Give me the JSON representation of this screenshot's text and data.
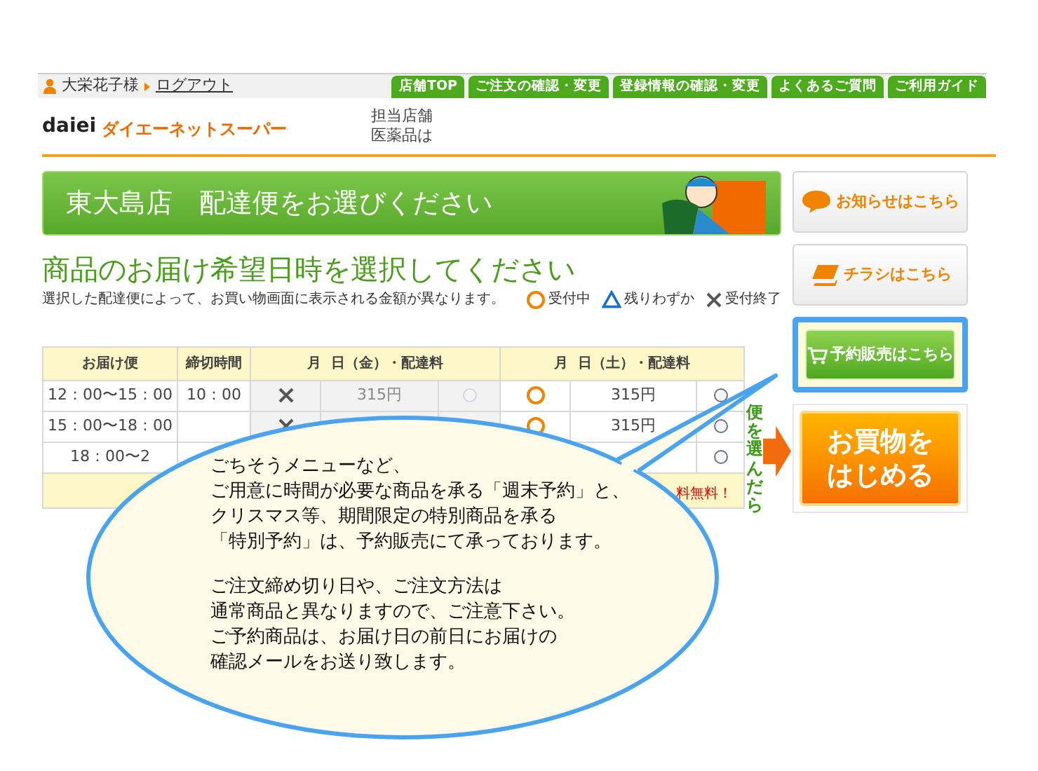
{
  "user": {
    "name": "大栄花子様",
    "logout": "ログアウト"
  },
  "nav": [
    "店舗TOP",
    "ご注文の確認・変更",
    "登録情報の確認・変更",
    "よくあるご質問",
    "ご利用ガイド"
  ],
  "logo": {
    "mark": "daiei",
    "name": "ダイエーネットスーパー"
  },
  "store_info": [
    "担当店舗",
    "医薬品は"
  ],
  "banner": {
    "title": "東大島店　配達便をお選びください"
  },
  "heading": "商品のお届け希望日時を選択してください",
  "subtext": "選択した配達便によって、お買い物画面に表示される金額が異なります。",
  "legend": [
    {
      "kind": "circle",
      "label": "受付中"
    },
    {
      "kind": "triangle",
      "label": "残りわずか"
    },
    {
      "kind": "cross",
      "label": "受付終了"
    }
  ],
  "table": {
    "columns": [
      "お届け便",
      "締切時間",
      "月  日（金）・配達料",
      "月  日（土）・配達料"
    ],
    "rows": [
      {
        "time": "12：00〜15：00",
        "deadline": "10：00",
        "fri": {
          "kind": "cross",
          "fee": "315円",
          "radio": {
            "selected": false,
            "disabled": true
          }
        },
        "sat": {
          "kind": "circle",
          "fee": "315円",
          "radio": {
            "selected": false,
            "disabled": false
          }
        }
      },
      {
        "time": "15：00〜18：00",
        "fri": {
          "kind": "cross"
        },
        "sat": {
          "kind": "circle",
          "fee": "315円",
          "radio": {
            "selected": false,
            "disabled": false
          }
        }
      },
      {
        "time": "18：00〜2",
        "sat": {
          "radio": {
            "selected": false,
            "disabled": false
          }
        }
      }
    ],
    "footer": "料無料！"
  },
  "side_buttons": [
    {
      "kind": "notice",
      "label": "お知らせはこちら",
      "highlighted": false
    },
    {
      "kind": "flyer",
      "label": "チラシはこちら",
      "highlighted": false
    },
    {
      "kind": "reserve",
      "label": "予約販売はこちら",
      "highlighted": true
    }
  ],
  "start": {
    "hint": "便を選んだら",
    "lines": [
      "お買物を",
      "はじめる"
    ]
  },
  "callout": {
    "paragraphs": [
      [
        "ごちそうメニューなど、",
        "ご用意に時間が必要な商品を承る「週末予約」と、",
        "クリスマス等、期間限定の特別商品を承る",
        "「特別予約」は、予約販売にて承っております。"
      ],
      [
        "ご注文締め切り日や、ご注文方法は",
        "通常商品と異なりますので、ご注意下さい。",
        "ご予約商品は、お届け日の前日にお届けの",
        "確認メールをお送り致します。"
      ]
    ]
  }
}
